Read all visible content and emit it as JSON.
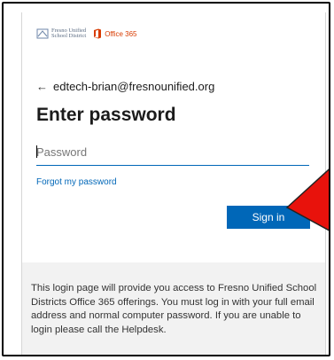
{
  "logos": {
    "district": "Fresno Unified School District",
    "district_line1": "Fresno Unified",
    "district_line2": "School District",
    "office": "Office 365",
    "office_color": "#d83b01"
  },
  "account": {
    "back_icon": "back-arrow-icon",
    "email": "edtech-brian@fresnounified.org"
  },
  "title": "Enter password",
  "password": {
    "placeholder": "Password",
    "value": ""
  },
  "forgot_link": "Forgot my password",
  "signin_label": "Sign in",
  "info_text": "This login page will provide you access to Fresno Unified School Districts Office 365 offerings. You must log in with your full email address and normal computer password. If you are unable to login please call the Helpdesk.",
  "colors": {
    "accent": "#0067b8",
    "annotation_arrow": "#e8120c",
    "panel_bg": "#f2f2f2"
  }
}
